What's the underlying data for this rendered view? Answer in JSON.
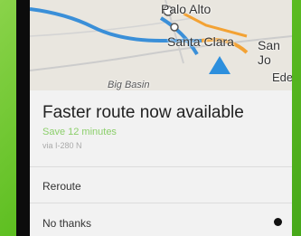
{
  "map": {
    "labels": {
      "palo_alto": "Palo Alto",
      "santa_clara": "Santa Clara",
      "san_jose": "San Jo",
      "edge": "Ede",
      "big_basin": "Big Basin"
    }
  },
  "dialog": {
    "title": "Faster route now available",
    "subtitle": "Save 12 minutes",
    "route": "via I-280 N",
    "reroute_label": "Reroute",
    "no_thanks_label": "No thanks"
  },
  "colors": {
    "subtitle": "#8ccf6b",
    "route_blue": "#3a8fd8",
    "route_orange": "#f3a234",
    "map_bg": "#e9e6df"
  }
}
